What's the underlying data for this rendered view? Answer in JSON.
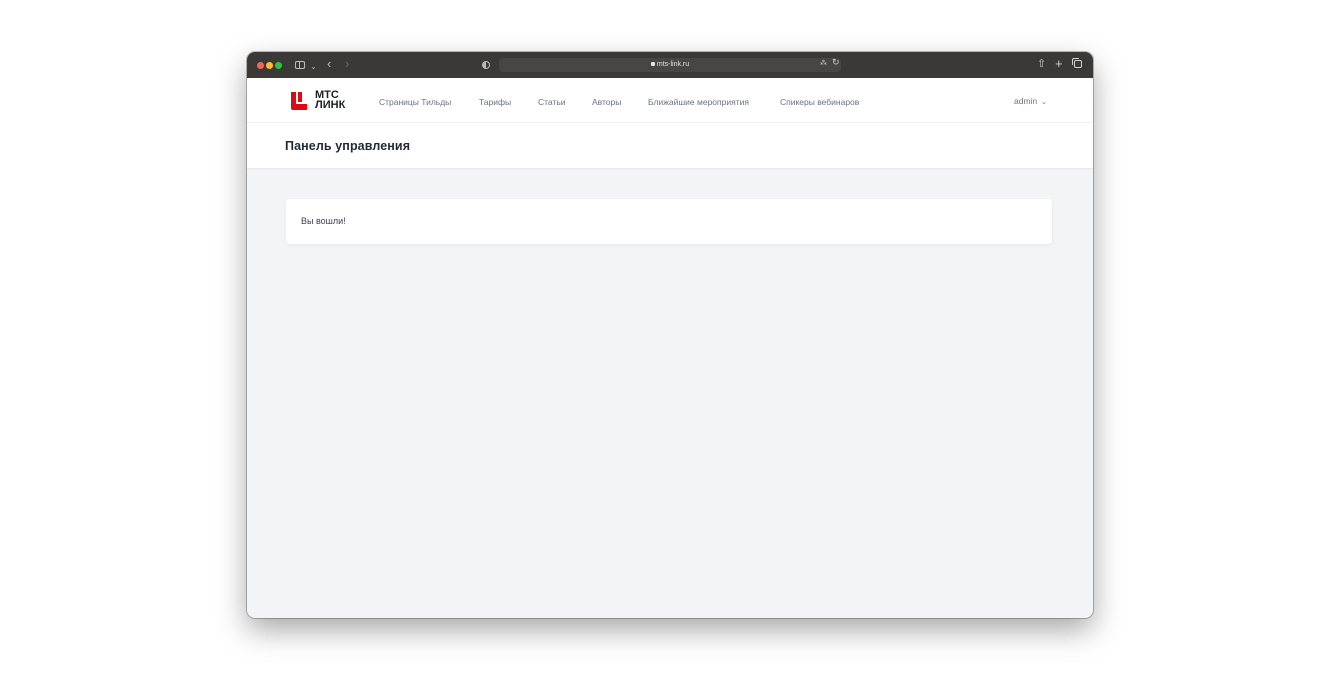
{
  "browser": {
    "url": "mts-link.ru"
  },
  "nav": {
    "logo_line1": "МТС",
    "logo_line2": "ЛИНК",
    "links": [
      "Страницы Тильды",
      "Тарифы",
      "Статьи",
      "Авторы",
      "Ближайшие мероприятия",
      "Спикеры вебинаров"
    ],
    "user": "admin",
    "brand_color": "#e30613"
  },
  "header": {
    "title": "Панель управления"
  },
  "main": {
    "message": "Вы вошли!"
  }
}
